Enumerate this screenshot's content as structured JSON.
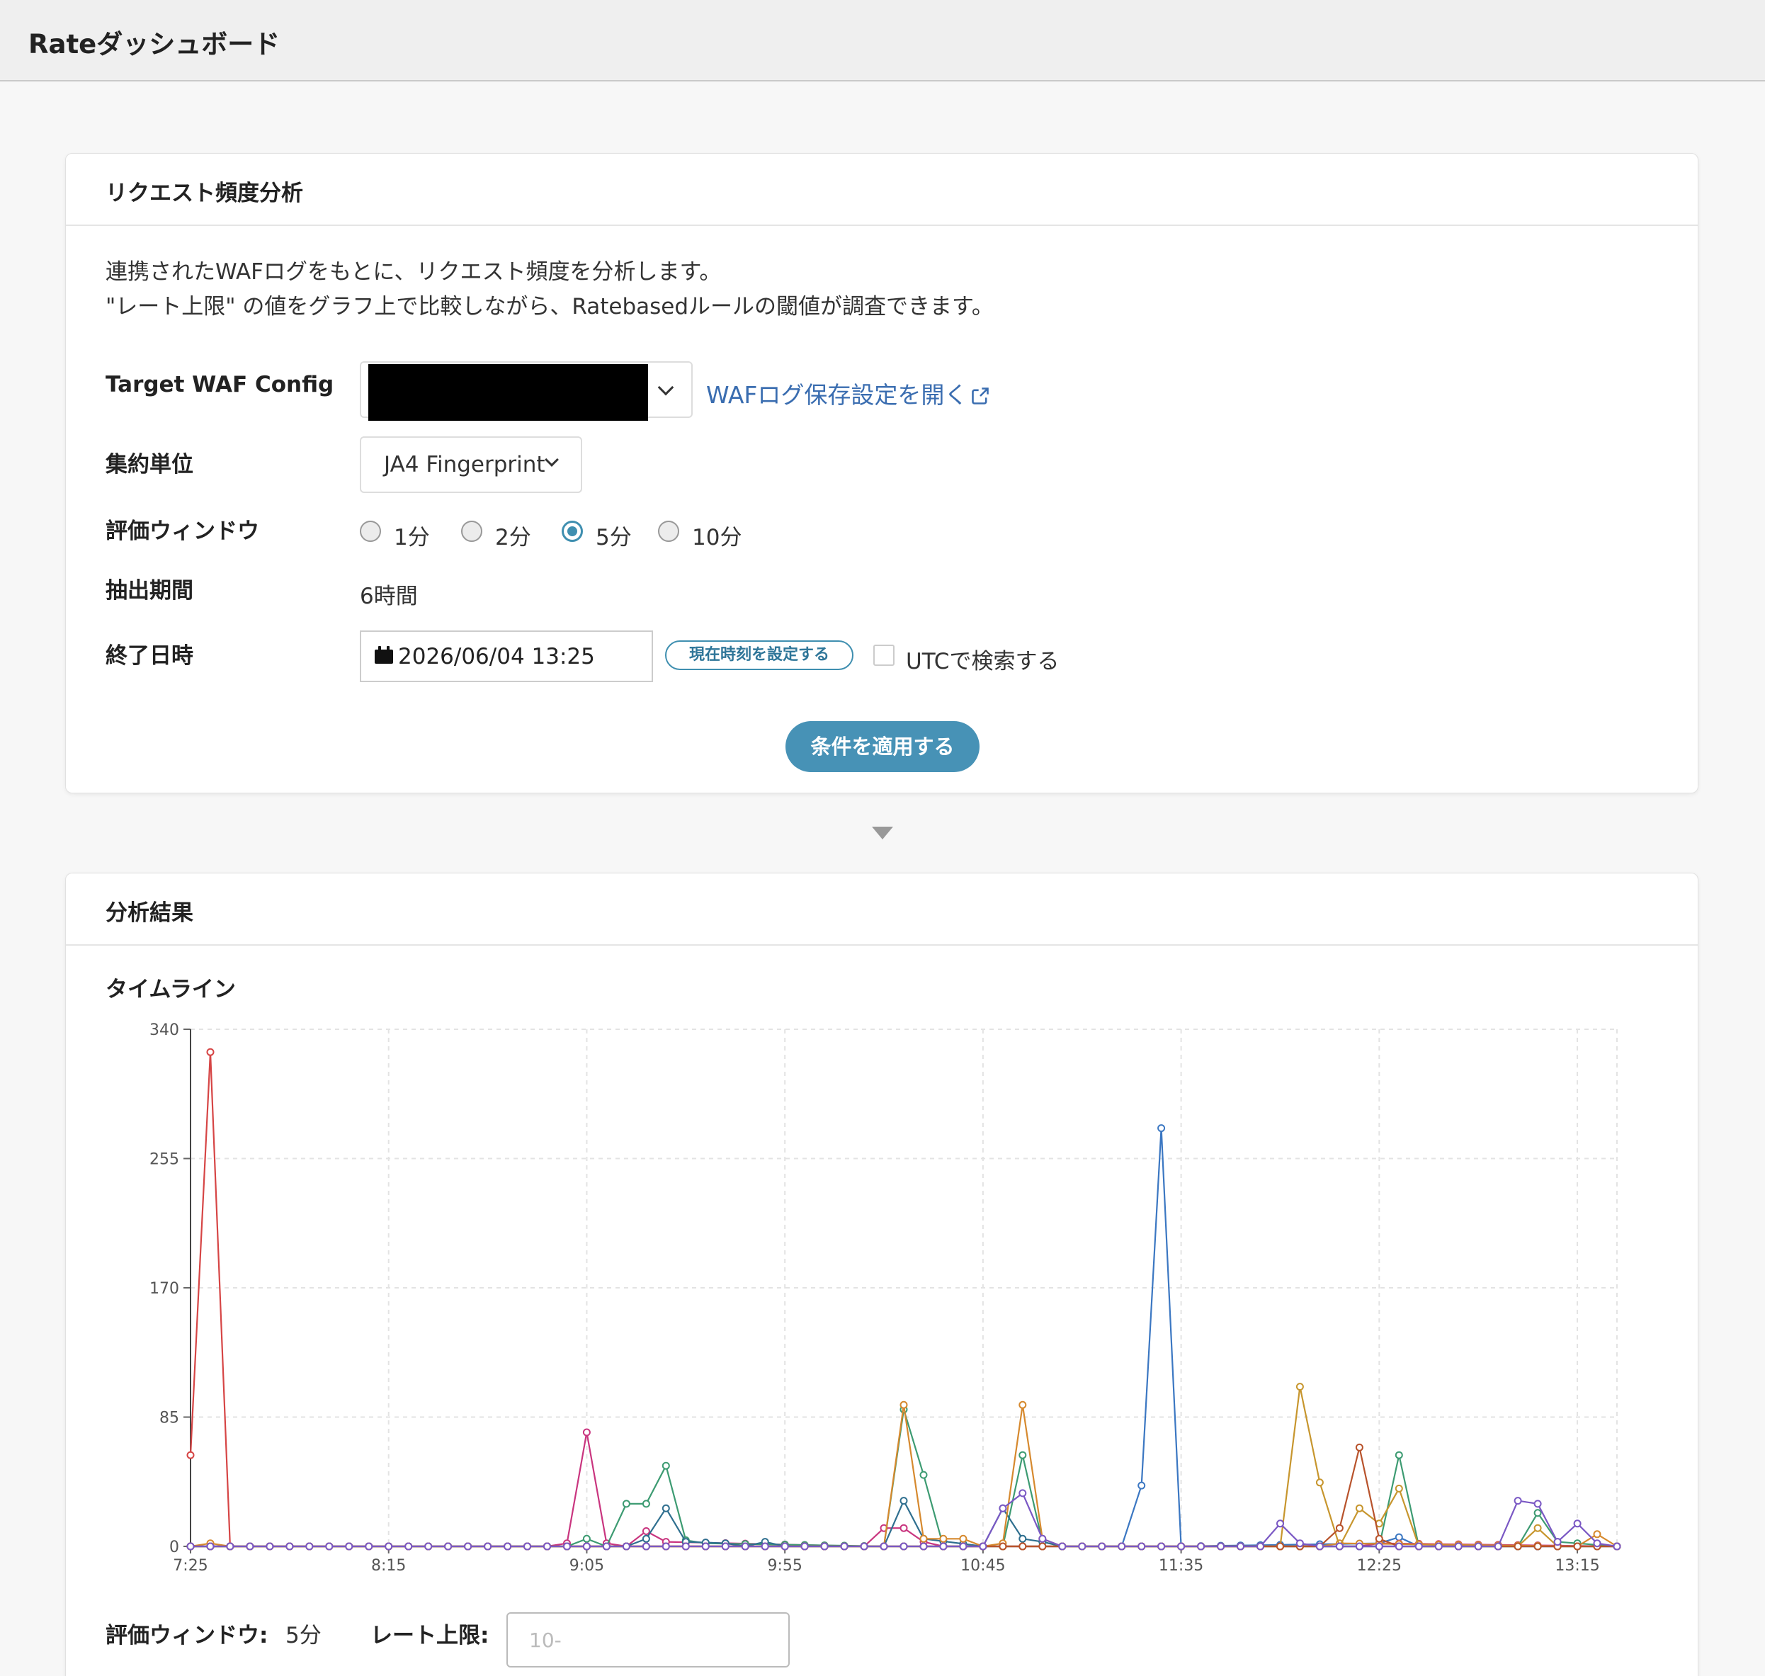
{
  "app": {
    "title": "Rateダッシュボード"
  },
  "request_panel": {
    "title": "リクエスト頻度分析",
    "description_line1": "連携されたWAFログをもとに、リクエスト頻度を分析します。",
    "description_line2": "\"レート上限\" の値をグラフ上で比較しながら、Ratebasedルールの閾値が調査できます。",
    "target_label": "Target WAF Config",
    "waf_link_label": "WAFログ保存設定を開く",
    "aggregation_label": "集約単位",
    "aggregation_value": "JA4 Fingerprint",
    "window_label": "評価ウィンドウ",
    "window_options": [
      {
        "label": "1分",
        "checked": false
      },
      {
        "label": "2分",
        "checked": false
      },
      {
        "label": "5分",
        "checked": true
      },
      {
        "label": "10分",
        "checked": false
      }
    ],
    "period_label": "抽出期間",
    "period_value": "6時間",
    "end_label": "終了日時",
    "end_value": "2026/06/04 13:25",
    "now_button": "現在時刻を設定する",
    "utc_label": "UTCで検索する",
    "utc_checked": false,
    "apply_button": "条件を適用する"
  },
  "results_panel": {
    "title": "分析結果",
    "timeline_label": "タイムライン",
    "window_label": "評価ウィンドウ:",
    "window_value": "5分",
    "rate_label": "レート上限:",
    "rate_placeholder": "10-"
  },
  "chart_data": {
    "type": "line",
    "ylim": [
      0,
      340
    ],
    "yticks": [
      0,
      85,
      170,
      255,
      340
    ],
    "xticks": [
      "7:25",
      "8:15",
      "9:05",
      "9:55",
      "10:45",
      "11:35",
      "12:25",
      "13:15"
    ],
    "x_start": "7:25",
    "x_end": "13:25",
    "grid": true,
    "legend": "none",
    "series": [
      {
        "color": "#d64545",
        "points": [
          [
            "7:25",
            60
          ],
          [
            "7:30",
            325
          ],
          [
            "7:35",
            0
          ],
          [
            "13:25",
            0
          ]
        ]
      },
      {
        "color": "#3b77c2",
        "points": [
          [
            "7:25",
            0
          ],
          [
            "11:20",
            0
          ],
          [
            "11:25",
            40
          ],
          [
            "11:30",
            275
          ],
          [
            "11:35",
            0
          ],
          [
            "12:25",
            2
          ],
          [
            "12:30",
            6
          ],
          [
            "12:35",
            0
          ],
          [
            "13:25",
            0
          ]
        ]
      },
      {
        "color": "#c9357f",
        "points": [
          [
            "7:25",
            0
          ],
          [
            "8:55",
            0
          ],
          [
            "9:00",
            2
          ],
          [
            "9:05",
            75
          ],
          [
            "9:10",
            2
          ],
          [
            "9:15",
            0
          ],
          [
            "9:20",
            10
          ],
          [
            "9:25",
            3
          ],
          [
            "10:15",
            0
          ],
          [
            "10:20",
            12
          ],
          [
            "10:25",
            12
          ],
          [
            "10:30",
            3
          ],
          [
            "10:35",
            0
          ],
          [
            "12:20",
            0
          ],
          [
            "12:25",
            2
          ],
          [
            "13:25",
            0
          ]
        ]
      },
      {
        "color": "#3d9b72",
        "points": [
          [
            "7:25",
            0
          ],
          [
            "9:00",
            0
          ],
          [
            "9:05",
            5
          ],
          [
            "9:10",
            0
          ],
          [
            "9:15",
            28
          ],
          [
            "9:20",
            28
          ],
          [
            "9:25",
            53
          ],
          [
            "9:30",
            4
          ],
          [
            "9:35",
            2
          ],
          [
            "10:20",
            0
          ],
          [
            "10:25",
            90
          ],
          [
            "10:30",
            47
          ],
          [
            "10:35",
            0
          ],
          [
            "10:50",
            0
          ],
          [
            "10:55",
            60
          ],
          [
            "11:00",
            3
          ],
          [
            "11:05",
            0
          ],
          [
            "12:25",
            0
          ],
          [
            "12:30",
            60
          ],
          [
            "12:35",
            0
          ],
          [
            "13:00",
            0
          ],
          [
            "13:05",
            22
          ],
          [
            "13:10",
            3
          ],
          [
            "13:25",
            0
          ]
        ]
      },
      {
        "color": "#2f6f8f",
        "points": [
          [
            "7:25",
            0
          ],
          [
            "9:15",
            0
          ],
          [
            "9:20",
            5
          ],
          [
            "9:25",
            25
          ],
          [
            "9:30",
            3
          ],
          [
            "9:40",
            2
          ],
          [
            "9:45",
            0
          ],
          [
            "9:50",
            3
          ],
          [
            "9:55",
            0
          ],
          [
            "10:20",
            0
          ],
          [
            "10:25",
            30
          ],
          [
            "10:30",
            5
          ],
          [
            "10:45",
            0
          ],
          [
            "10:50",
            25
          ],
          [
            "10:55",
            5
          ],
          [
            "11:00",
            3
          ],
          [
            "11:05",
            0
          ],
          [
            "13:25",
            0
          ]
        ]
      },
      {
        "color": "#d6892e",
        "points": [
          [
            "7:25",
            0
          ],
          [
            "7:30",
            2
          ],
          [
            "7:35",
            0
          ],
          [
            "10:20",
            0
          ],
          [
            "10:25",
            93
          ],
          [
            "10:30",
            5
          ],
          [
            "10:40",
            5
          ],
          [
            "10:45",
            0
          ],
          [
            "10:50",
            2
          ],
          [
            "10:55",
            93
          ],
          [
            "11:00",
            5
          ],
          [
            "11:05",
            0
          ],
          [
            "12:10",
            0
          ],
          [
            "12:15",
            2
          ],
          [
            "13:15",
            0
          ],
          [
            "13:20",
            8
          ],
          [
            "13:25",
            0
          ]
        ]
      },
      {
        "color": "#c7962e",
        "points": [
          [
            "7:25",
            0
          ],
          [
            "12:00",
            0
          ],
          [
            "12:05",
            105
          ],
          [
            "12:10",
            42
          ],
          [
            "12:15",
            0
          ],
          [
            "12:20",
            25
          ],
          [
            "12:25",
            15
          ],
          [
            "12:30",
            38
          ],
          [
            "12:35",
            0
          ],
          [
            "13:00",
            0
          ],
          [
            "13:05",
            12
          ],
          [
            "13:10",
            0
          ],
          [
            "13:25",
            0
          ]
        ]
      },
      {
        "color": "#b8532c",
        "points": [
          [
            "7:25",
            0
          ],
          [
            "12:10",
            0
          ],
          [
            "12:15",
            12
          ],
          [
            "12:20",
            65
          ],
          [
            "12:25",
            5
          ],
          [
            "12:30",
            0
          ],
          [
            "13:25",
            0
          ]
        ]
      },
      {
        "color": "#7a58c4",
        "points": [
          [
            "7:25",
            0
          ],
          [
            "10:45",
            0
          ],
          [
            "10:50",
            25
          ],
          [
            "10:55",
            35
          ],
          [
            "11:00",
            5
          ],
          [
            "11:05",
            0
          ],
          [
            "11:55",
            0
          ],
          [
            "12:00",
            15
          ],
          [
            "12:05",
            2
          ],
          [
            "12:10",
            0
          ],
          [
            "12:55",
            0
          ],
          [
            "13:00",
            30
          ],
          [
            "13:05",
            28
          ],
          [
            "13:10",
            3
          ],
          [
            "13:15",
            15
          ],
          [
            "13:20",
            2
          ],
          [
            "13:25",
            0
          ]
        ]
      }
    ]
  }
}
